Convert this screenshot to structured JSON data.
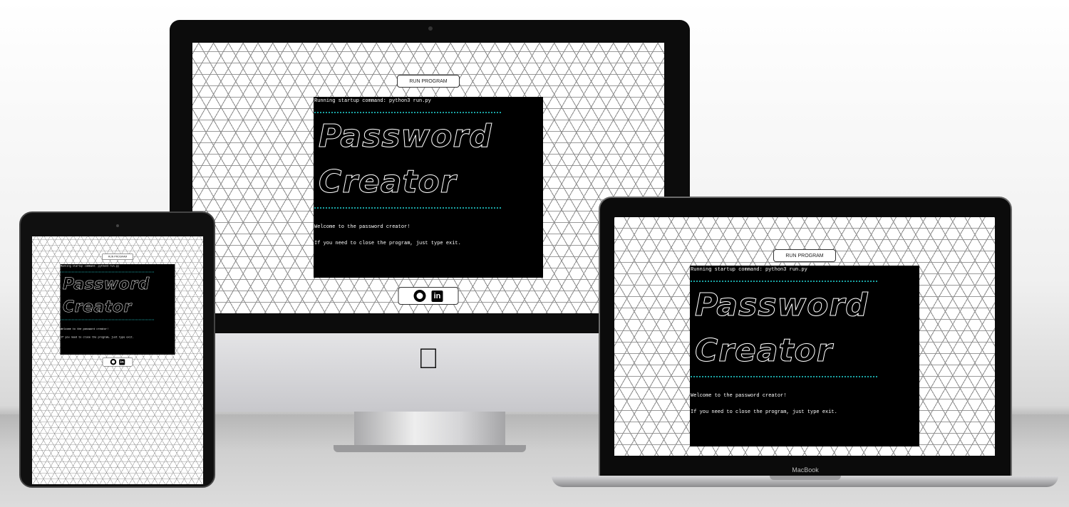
{
  "app": {
    "run_button_label": "RUN PROGRAM",
    "terminal": {
      "startup_line": "Running startup command: python3 run.py",
      "ascii_title_line1": "Password",
      "ascii_title_line2": "Creator",
      "welcome_line": "Welcome to the password creator!",
      "exit_line": "If you need to close the program, just type exit.",
      "rule_color": "#1aa3a3"
    },
    "social": {
      "github_icon": "github-icon",
      "linkedin_icon": "linkedin-icon",
      "linkedin_glyph": "in"
    }
  },
  "devices": {
    "imac": {
      "logo": "apple-logo"
    },
    "macbook": {
      "label": "MacBook"
    },
    "ipad": {}
  }
}
